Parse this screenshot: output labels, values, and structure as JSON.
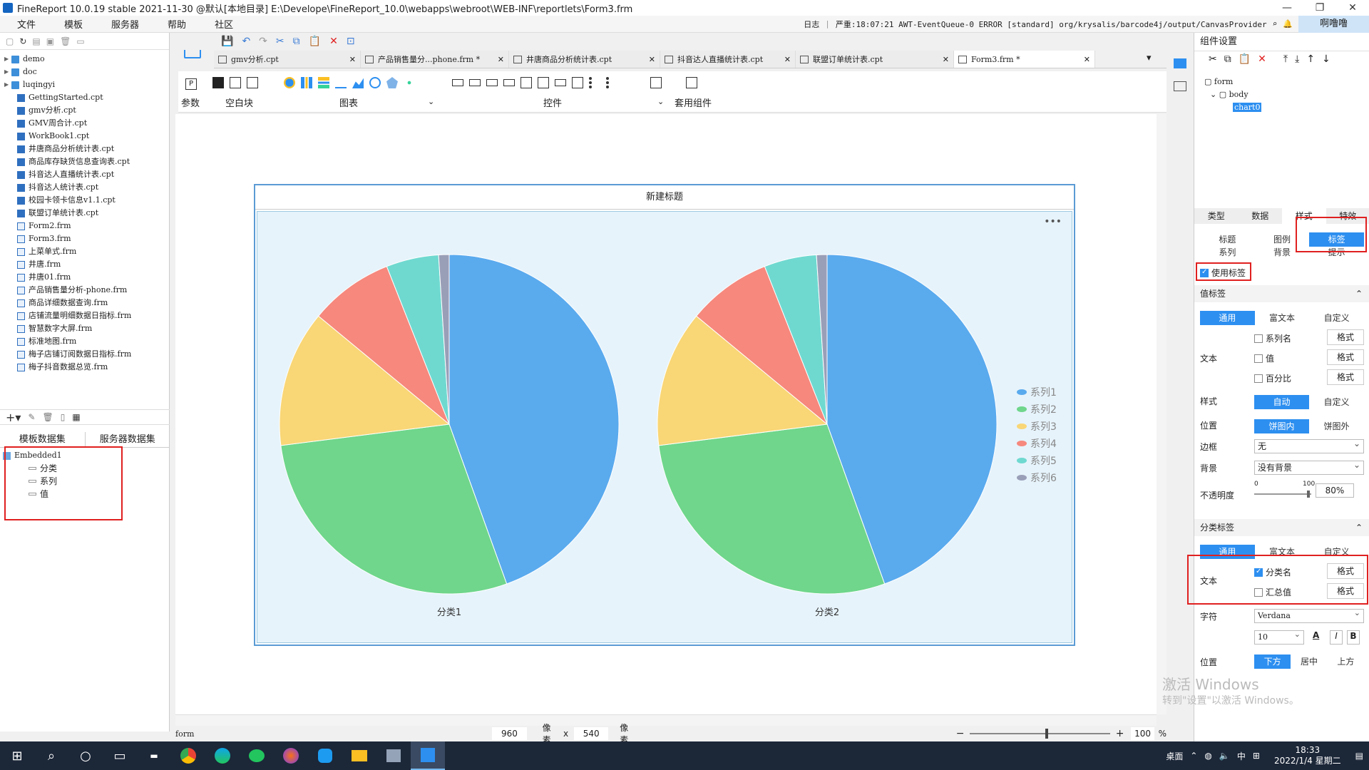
{
  "window": {
    "title": "FineReport 10.0.19 stable 2021-11-30 @默认[本地目录]    E:\\Develope\\FineReport_10.0\\webapps\\webroot\\WEB-INF\\reportlets\\Form3.frm",
    "minimize": "—",
    "maximize": "❐",
    "close": "✕"
  },
  "menu": {
    "items": [
      "文件",
      "模板",
      "服务器",
      "帮助",
      "社区"
    ],
    "log_label": "日志",
    "log_text": "严重:18:07:21 AWT-EventQueue-0 ERROR [standard] org/krysalis/barcode4j/output/CanvasProvider",
    "user": "啊噜噜"
  },
  "filetree": {
    "folders": [
      "demo",
      "doc",
      "luqingyi"
    ],
    "files": [
      "GettingStarted.cpt",
      "gmv分析.cpt",
      "GMV周合计.cpt",
      "WorkBook1.cpt",
      "井唐商品分析统计表.cpt",
      "商品库存缺货信息查询表.cpt",
      "抖音达人直播统计表.cpt",
      "抖音达人统计表.cpt",
      "校园卡领卡信息v1.1.cpt",
      "联盟订单统计表.cpt",
      "Form2.frm",
      "Form3.frm",
      "上菜单式.frm",
      "井唐.frm",
      "井唐01.frm",
      "产品销售量分析-phone.frm",
      "商品详细数据查询.frm",
      "店铺流量明细数据日指标.frm",
      "智慧数字大屏.frm",
      "标准地图.frm",
      "梅子店铺订阅数据日指标.frm",
      "梅子抖音数据总览.frm"
    ]
  },
  "dataset": {
    "tabs": [
      "模板数据集",
      "服务器数据集"
    ],
    "root": "Embedded1",
    "fields": [
      "分类",
      "系列",
      "值"
    ]
  },
  "tabs": [
    {
      "label": "gmv分析.cpt",
      "active": false
    },
    {
      "label": "产品销售量分...phone.frm *",
      "active": false
    },
    {
      "label": "井唐商品分析统计表.cpt",
      "active": false
    },
    {
      "label": "抖音达人直播统计表.cpt",
      "active": false
    },
    {
      "label": "联盟订单统计表.cpt",
      "active": false
    },
    {
      "label": "Form3.frm *",
      "active": true
    }
  ],
  "components": {
    "param": "参数",
    "blank": "空白块",
    "chart": "图表",
    "controls": "控件",
    "templates": "套用组件"
  },
  "chart_data": {
    "type": "pie",
    "title": "新建标题",
    "menu_icon": "•••",
    "series_names": [
      "系列1",
      "系列2",
      "系列3",
      "系列4",
      "系列5",
      "系列6"
    ],
    "series_colors": [
      "#5aaaee",
      "#6fd68b",
      "#f9d676",
      "#f6887d",
      "#6fd9d0",
      "#9a9fb8"
    ],
    "legend_position": "right",
    "pies": [
      {
        "category": "分类1",
        "values": [
          44.5,
          28.5,
          13,
          8,
          5,
          1
        ]
      },
      {
        "category": "分类2",
        "values": [
          44.5,
          28.5,
          13,
          8,
          5,
          1
        ]
      }
    ]
  },
  "status": {
    "form": "form",
    "width": "960",
    "width_unit": "像素",
    "x": "x",
    "height": "540",
    "height_unit": "像素",
    "zoom": "100",
    "zoom_unit": "%"
  },
  "right": {
    "header": "组件设置",
    "tree": {
      "form": "form",
      "body": "body",
      "chart": "chart0"
    },
    "main_tabs": [
      "类型",
      "数据",
      "样式",
      "特效"
    ],
    "sub_tabs_row1": [
      "标题",
      "图例",
      "标签"
    ],
    "sub_tabs_row2": [
      "系列",
      "背景",
      "提示"
    ],
    "use_label": "使用标签",
    "value_label_header": "值标签",
    "mode_tabs": [
      "通用",
      "富文本",
      "自定义"
    ],
    "text_label": "文本",
    "opt_series": "系列名",
    "opt_value": "值",
    "opt_percent": "百分比",
    "format": "格式",
    "style_label": "样式",
    "style_opts": [
      "自动",
      "自定义"
    ],
    "position_label": "位置",
    "position_opts": [
      "饼图内",
      "饼图外"
    ],
    "border_label": "边框",
    "border_value": "无",
    "bg_label": "背景",
    "bg_value": "没有背景",
    "opacity_label": "不透明度",
    "opacity_min": "0",
    "opacity_max": "100",
    "opacity_value": "80%",
    "category_label_header": "分类标签",
    "opt_category": "分类名",
    "opt_total": "汇总值",
    "font_label": "字符",
    "font_value": "Verdana",
    "font_size": "10",
    "pos2_opts": [
      "下方",
      "居中",
      "上方"
    ]
  },
  "watermark": {
    "line1": "激活 Windows",
    "line2": "转到\"设置\"以激活 Windows。"
  },
  "taskbar": {
    "desktop": "桌面",
    "ime": "中",
    "time": "18:33",
    "date": "2022/1/4 星期二"
  }
}
